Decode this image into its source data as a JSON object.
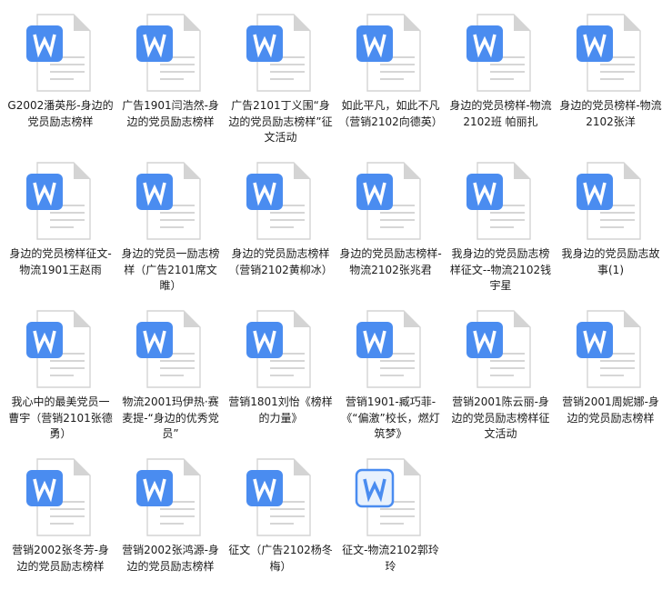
{
  "colors": {
    "page_corner": "#d4d4d4",
    "word_badge": "#4a8cf0",
    "word_badge_outlined_fill": "#e8f1fd",
    "text_lines": "#d6d6d6"
  },
  "files": [
    {
      "name": "G2002潘英彤-身边的党员励志榜样",
      "icon": "word-doc-icon"
    },
    {
      "name": "广告1901闫浩然-身边的党员励志榜样",
      "icon": "word-doc-icon"
    },
    {
      "name": "广告2101丁义围“身边的党员励志榜样”征文活动",
      "icon": "word-doc-icon"
    },
    {
      "name": "如此平凡，如此不凡（营销2102向德英）",
      "icon": "word-doc-icon"
    },
    {
      "name": "身边的党员榜样-物流2102班 帕丽扎",
      "icon": "word-doc-icon"
    },
    {
      "name": "身边的党员榜样-物流2102张洋",
      "icon": "word-doc-icon"
    },
    {
      "name": "身边的党员榜样征文-物流1901王赵雨",
      "icon": "word-doc-icon"
    },
    {
      "name": "身边的党员一励志榜样（广告2101席文睢）",
      "icon": "word-doc-icon"
    },
    {
      "name": "身边的党员励志榜样（营销2102黄柳冰）",
      "icon": "word-doc-icon"
    },
    {
      "name": "身边的党员励志榜样-物流2102张兆君",
      "icon": "word-doc-icon"
    },
    {
      "name": "我身边的党员励志榜样征文--物流2102钱宇星",
      "icon": "word-doc-icon"
    },
    {
      "name": "我身边的党员励志故事(1)",
      "icon": "word-doc-icon"
    },
    {
      "name": "我心中的最美党员一曹宇（营销2101张德勇）",
      "icon": "word-doc-icon"
    },
    {
      "name": "物流2001玛伊热·赛麦提-“身边的优秀党员”",
      "icon": "word-doc-icon"
    },
    {
      "name": "营销1801刘怡《榜样的力量》",
      "icon": "word-doc-icon"
    },
    {
      "name": "营销1901-臧巧菲-《“偏激”校长，燃灯筑梦》",
      "icon": "word-doc-icon"
    },
    {
      "name": "营销2001陈云丽-身边的党员励志榜样征文活动",
      "icon": "word-doc-icon"
    },
    {
      "name": "营销2001周妮娜-身边的党员励志榜样",
      "icon": "word-doc-icon"
    },
    {
      "name": "营销2002张冬芳-身边的党员励志榜样",
      "icon": "word-doc-icon"
    },
    {
      "name": "营销2002张鸿源-身边的党员励志榜样",
      "icon": "word-doc-icon"
    },
    {
      "name": "征文（广告2102杨冬梅）",
      "icon": "word-doc-icon"
    },
    {
      "name": "征文-物流2102郭玲玲",
      "icon": "word-doc-outlined-icon"
    }
  ]
}
